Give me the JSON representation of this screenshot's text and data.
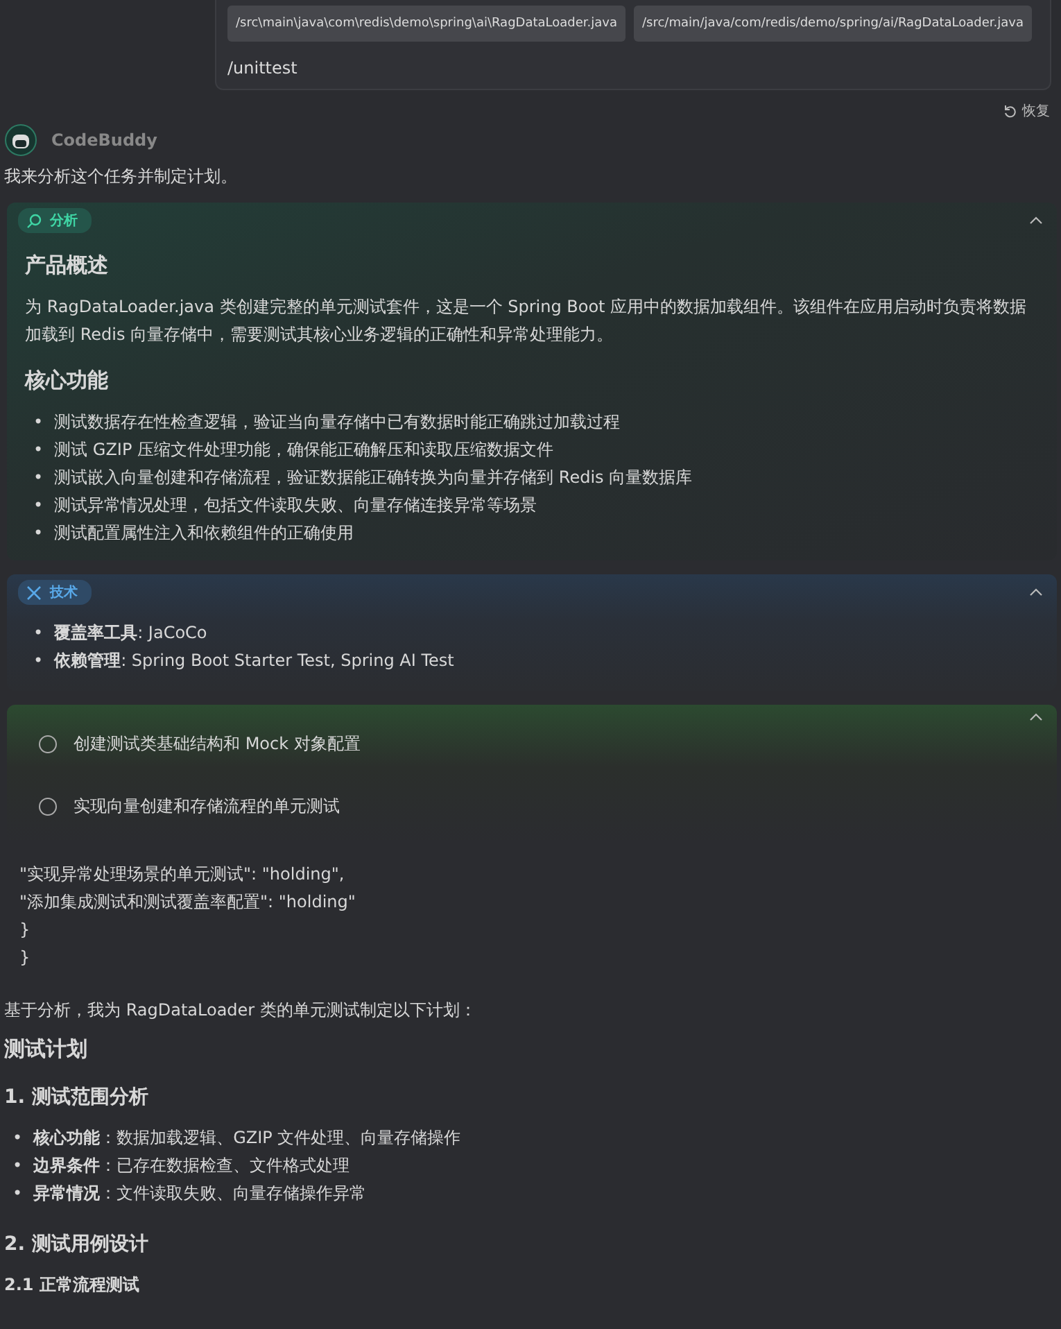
{
  "user_message": {
    "attachments": [
      "/src\\main\\java\\com\\redis\\demo\\spring\\ai\\RagDataLoader.java",
      "/src/main/java/com/redis/demo/spring/ai/RagDataLoader.java"
    ],
    "text": "/unittest"
  },
  "restore_button": "恢复",
  "assistant": {
    "name": "CodeBuddy",
    "intro": "我来分析这个任务并制定计划。"
  },
  "panels": [
    {
      "kind": "analysis",
      "label": "分析",
      "expanded": true,
      "blocks": [
        {
          "kind": "heading",
          "text": "产品概述"
        },
        {
          "kind": "paragraph",
          "text": "为 RagDataLoader.java 类创建完整的单元测试套件，这是一个 Spring Boot 应用中的数据加载组件。该组件在应用启动时负责将数据加载到 Redis 向量存储中，需要测试其核心业务逻辑的正确性和异常处理能力。"
        },
        {
          "kind": "heading",
          "text": "核心功能"
        },
        {
          "kind": "list",
          "bullet": "•",
          "items": [
            "测试数据存在性检查逻辑，验证当向量存储中已有数据时能正确跳过加载过程",
            "测试 GZIP 压缩文件处理功能，确保能正确解压和读取压缩数据文件",
            "测试嵌入向量创建和存储流程，验证数据能正确转换为向量并存储到 Redis 向量数据库",
            "测试异常情况处理，包括文件读取失败、向量存储连接异常等场景",
            "测试配置属性注入和依赖组件的正确使用"
          ]
        }
      ]
    },
    {
      "kind": "tech",
      "label": "技术",
      "expanded": true,
      "blocks": [
        {
          "kind": "list",
          "bullet": "•",
          "items": [
            "**覆盖率工具**: JaCoCo",
            "**依赖管理**: Spring Boot Starter Test, Spring AI Test"
          ]
        }
      ]
    },
    {
      "kind": "plan",
      "expanded": true,
      "blocks": [
        {
          "kind": "tasks",
          "items": [
            {
              "text": "创建测试类基础结构和 Mock 对象配置",
              "checked": false
            },
            {
              "text": "实现向量创建和存储流程的单元测试",
              "checked": false
            }
          ]
        }
      ]
    }
  ],
  "json_lines": [
    "\"实现异常处理场景的单元测试\": \"holding\",",
    "\"添加集成测试和测试覆盖率配置\": \"holding\"",
    "}",
    "}"
  ],
  "summary": "基于分析，我为 RagDataLoader 类的单元测试制定以下计划：",
  "plan": [
    {
      "kind": "h2",
      "text": "测试计划"
    },
    {
      "kind": "h3",
      "text": "1. 测试范围分析"
    },
    {
      "kind": "list",
      "bullet": "•",
      "items": [
        "**核心功能**：数据加载逻辑、GZIP 文件处理、向量存储操作",
        "**边界条件**：已存在数据检查、文件格式处理",
        "**异常情况**：文件读取失败、向量存储操作异常"
      ]
    },
    {
      "kind": "h3",
      "text": "2. 测试用例设计"
    },
    {
      "kind": "h4",
      "text": "2.1 正常流程测试"
    }
  ]
}
